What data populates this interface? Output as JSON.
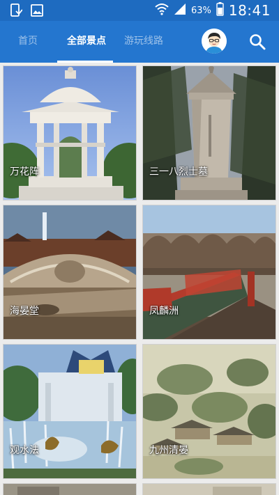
{
  "status_bar": {
    "battery_percent": "63%",
    "time": "18:41",
    "icons": [
      "phone-notification-icon",
      "image-notification-icon",
      "wifi-icon",
      "signal-icon",
      "battery-icon"
    ]
  },
  "header": {
    "tabs": [
      {
        "label": "首页",
        "active": false
      },
      {
        "label": "全部景点",
        "active": true
      },
      {
        "label": "游玩线路",
        "active": false
      }
    ],
    "avatar": "user-avatar-icon",
    "search": "search-icon"
  },
  "spots": [
    {
      "name": "万花阵"
    },
    {
      "name": "三一八烈士墓"
    },
    {
      "name": "海晏堂"
    },
    {
      "name": "凤麟洲"
    },
    {
      "name": "观水法"
    },
    {
      "name": "九州清晏"
    }
  ],
  "colors": {
    "status_bar": "#1e6bc0",
    "app_bar": "#2476cf",
    "background": "#ececec"
  }
}
